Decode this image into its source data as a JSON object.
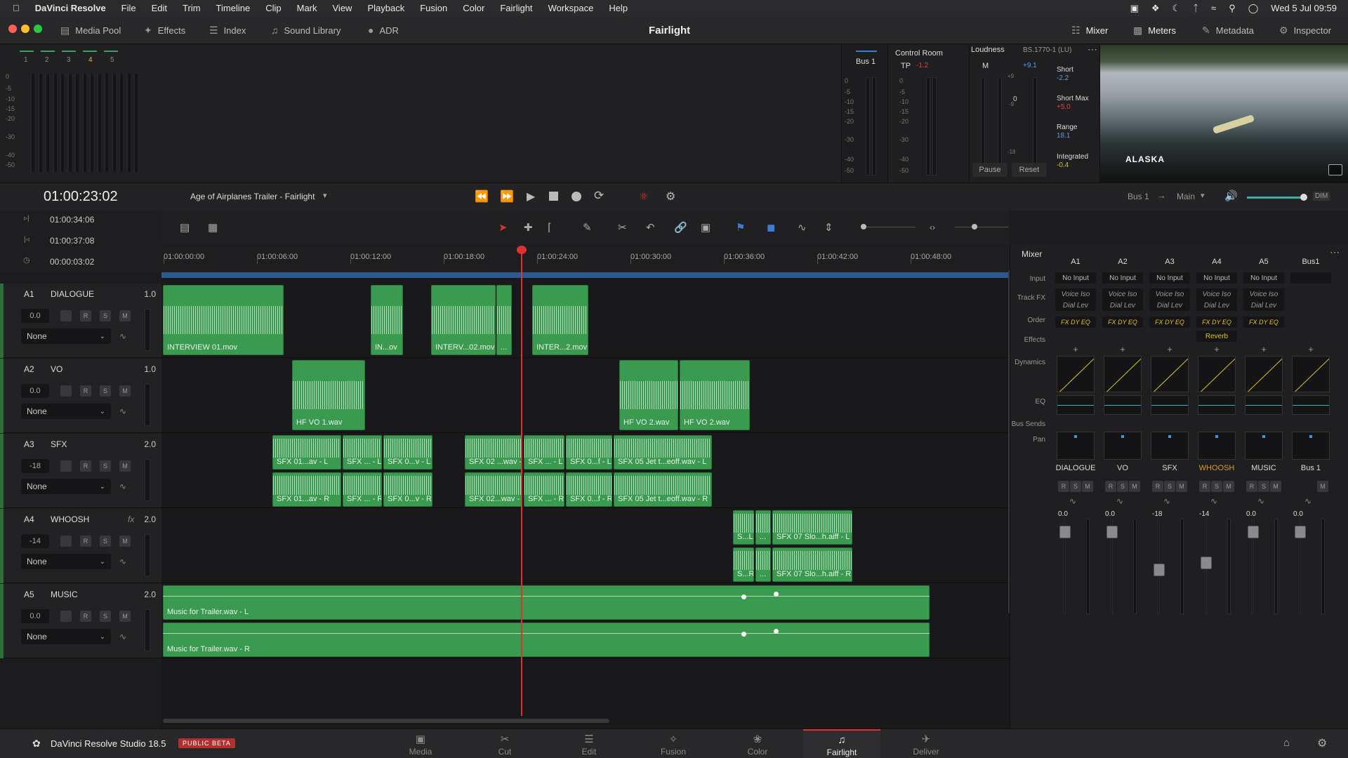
{
  "menubar": {
    "apple": "",
    "app": "DaVinci Resolve",
    "items": [
      "File",
      "Edit",
      "Trim",
      "Timeline",
      "Clip",
      "Mark",
      "View",
      "Playback",
      "Fusion",
      "Color",
      "Fairlight",
      "Workspace",
      "Help"
    ],
    "clock": "Wed 5 Jul  09:59"
  },
  "topbar": {
    "media_pool": "Media Pool",
    "effects": "Effects",
    "index": "Index",
    "sound_library": "Sound Library",
    "adr": "ADR",
    "title": "Fairlight",
    "mixer": "Mixer",
    "meters": "Meters",
    "metadata": "Metadata",
    "inspector": "Inspector"
  },
  "meters": {
    "numbers": [
      "1",
      "2",
      "3",
      "4",
      "5"
    ],
    "scale": [
      "0",
      "-5",
      "-10",
      "-15",
      "-20",
      "-30",
      "-40",
      "-50"
    ],
    "bus1_label": "Bus 1",
    "bus_scale": [
      "0",
      "-5",
      "-10",
      "-15",
      "-20",
      "-30",
      "-40",
      "-50"
    ]
  },
  "control_room": {
    "title": "Control Room",
    "tp_label": "TP",
    "tp_value": "-1.2",
    "scale": [
      "0",
      "-5",
      "-10",
      "-15",
      "-20",
      "-30",
      "-40",
      "-50"
    ]
  },
  "loudness": {
    "title": "Loudness",
    "standard": "BS.1770-1 (LU)",
    "m_label": "M",
    "m_value": "+9.1",
    "scale_left": [
      "+9",
      "0",
      "-9",
      "-18"
    ],
    "zero": "0",
    "short_label": "Short",
    "short_value": "-2.2",
    "short_max_label": "Short Max",
    "short_max_value": "+5.0",
    "range_label": "Range",
    "range_value": "18.1",
    "integrated_label": "Integrated",
    "integrated_value": "-0.4",
    "pause": "Pause",
    "reset": "Reset"
  },
  "video": {
    "caption": "ALASKA"
  },
  "transport": {
    "timecode": "01:00:23:02",
    "timeline_name": "Age of Airplanes Trailer - Fairlight",
    "bus": "Bus 1",
    "main": "Main",
    "dim": "DIM"
  },
  "timecodes": {
    "in": "01:00:34:06",
    "out": "01:00:37:08",
    "duration": "00:00:03:02"
  },
  "ruler": [
    "01:00:00:00",
    "01:00:06:00",
    "01:00:12:00",
    "01:00:18:00",
    "01:00:24:00",
    "01:00:30:00",
    "01:00:36:00",
    "01:00:42:00",
    "01:00:48:00"
  ],
  "tracks": [
    {
      "id": "A1",
      "name": "DIALOGUE",
      "level": "1.0",
      "vol": "0.0",
      "assign": "None"
    },
    {
      "id": "A2",
      "name": "VO",
      "level": "1.0",
      "vol": "0.0",
      "assign": "None"
    },
    {
      "id": "A3",
      "name": "SFX",
      "level": "2.0",
      "vol": "-18",
      "assign": "None"
    },
    {
      "id": "A4",
      "name": "WHOOSH",
      "level": "2.0",
      "vol": "-14",
      "assign": "None",
      "fx": "fx"
    },
    {
      "id": "A5",
      "name": "MUSIC",
      "level": "2.0",
      "vol": "0.0",
      "assign": "None"
    }
  ],
  "track_buttons": {
    "r": "R",
    "s": "S",
    "m": "M"
  },
  "clips": {
    "a1": [
      "INTERVIEW 01.mov",
      "IN...ov",
      "INTERV...02.mov",
      "...",
      "INTER...2.mov"
    ],
    "a2": [
      "HF VO 1.wav",
      "HF VO 2.wav",
      "HF VO 2.wav"
    ],
    "a3_top": [
      "SFX 01...av - L",
      "SFX ... - L",
      "SFX 0...v - L",
      "SFX 02 ...wav - L",
      "SFX ... - L",
      "SFX 0...f - L",
      "SFX 05 Jet t...eoff.wav - L"
    ],
    "a3_bot": [
      "SFX 01...av - R",
      "SFX ... - R",
      "SFX 0...v - R",
      "SFX 02...wav - R",
      "SFX ... - R",
      "SFX 0...f - R",
      "SFX 05 Jet t...eoff.wav - R"
    ],
    "a4_top": [
      "S...L",
      "...",
      "SFX 07 Slo...h.aiff - L"
    ],
    "a4_bot": [
      "S...R",
      "...",
      "SFX 07 Slo...h.aiff - R"
    ],
    "a5": [
      "Music for Trailer.wav - L",
      "Music for Trailer.wav - R"
    ]
  },
  "mixer": {
    "title": "Mixer",
    "columns": [
      "A1",
      "A2",
      "A3",
      "A4",
      "A5",
      "Bus1"
    ],
    "row_labels": [
      "Input",
      "Track FX",
      "Order",
      "Effects",
      "Dynamics",
      "EQ",
      "Bus Sends",
      "Pan"
    ],
    "input": "No Input",
    "voice_iso": "Voice Iso",
    "dial_lev": "Dial Lev",
    "order": "FX DY EQ",
    "reverb": "Reverb",
    "plus": "+",
    "strip_names": [
      "DIALOGUE",
      "VO",
      "SFX",
      "WHOOSH",
      "MUSIC",
      "Bus 1"
    ],
    "strip_values": [
      "0.0",
      "0.0",
      "-18",
      "-14",
      "0.0",
      "0.0"
    ],
    "fader_scale": [
      "0",
      "-5",
      "-10",
      "-15",
      "-20",
      "-30",
      "-40",
      "-50"
    ],
    "whoosh_color": "#d89b2a"
  },
  "pages": {
    "brand": "DaVinci Resolve Studio 18.5",
    "beta": "PUBLIC BETA",
    "items": [
      "Media",
      "Cut",
      "Edit",
      "Fusion",
      "Color",
      "Fairlight",
      "Deliver"
    ],
    "active": "Fairlight"
  },
  "colors": {
    "clip_green": "#3a9a50",
    "playhead": "#e03030",
    "accent_blue": "#3a7bd5"
  }
}
